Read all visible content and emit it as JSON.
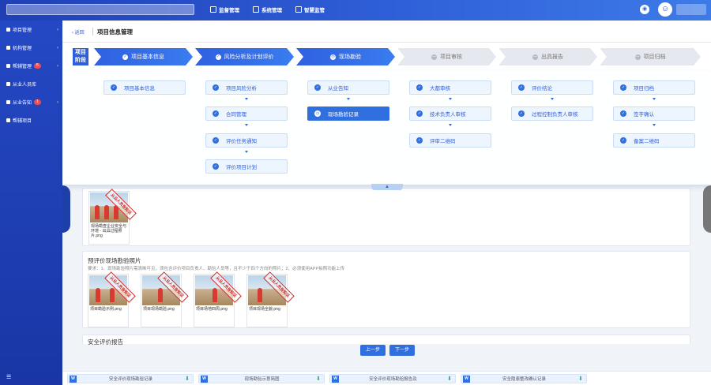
{
  "topbar": {
    "nav": [
      {
        "label": "监督管理",
        "icon": "grid-icon"
      },
      {
        "label": "系统管理",
        "icon": "settings-icon"
      },
      {
        "label": "智慧监管",
        "icon": "chart-icon"
      }
    ],
    "icon1": "◉",
    "icon2": "☺"
  },
  "sidebar": {
    "items": [
      {
        "label": "项目管理",
        "badge": ""
      },
      {
        "label": "机构管理",
        "badge": ""
      },
      {
        "label": "帮辅管理",
        "badge": "5"
      },
      {
        "label": "从业人员库",
        "badge": ""
      },
      {
        "label": "从业告知",
        "badge": "1"
      },
      {
        "label": "帮辅项目",
        "badge": ""
      }
    ],
    "footer": "☰"
  },
  "breadcrumb": {
    "back": "‹ 返回",
    "title": "项目信息管理"
  },
  "steps": {
    "phase_label": "项目阶段",
    "items": [
      {
        "label": "项目基本信息",
        "icon": "✓"
      },
      {
        "label": "风险分析及计划评价",
        "icon": "✓"
      },
      {
        "label": "现场勘验",
        "icon": "◷"
      },
      {
        "label": "项目审核",
        "icon": "—"
      },
      {
        "label": "出具报告",
        "icon": "—"
      },
      {
        "label": "项目归档",
        "icon": "—"
      }
    ]
  },
  "flow": {
    "col1": [
      "项目基本信息"
    ],
    "col2": [
      "项目风险分析",
      "合同管理",
      "评价任务通知",
      "评价项目计划"
    ],
    "col3": [
      "从业告知",
      "现场勘验记录"
    ],
    "col4": [
      "大都审核",
      "技术负责人审核",
      "评审二维码"
    ],
    "col5": [
      "评价结论",
      "过程控制负责人审核"
    ],
    "col6": [
      "项目归档",
      "签字确认",
      "备案二维码"
    ],
    "check": "✓",
    "current_icon": "◷",
    "toggle": "▲"
  },
  "upper_card": {
    "photo": {
      "caption": "现场勘查企业安全与环境 - 出具过程照片.png",
      "stamp": "从业人员告知证"
    }
  },
  "site_photos": {
    "title": "预评价现场勘验照片",
    "note": "要求：1、现场勘验照片需清晰可见，须包含评价项目负责人、勘验人员等，且不少于四个方向的照片；2、必须使用APP拍照功能上传",
    "photos": [
      {
        "caption": "项目勘验示例.png",
        "stamp": "从业人员告知证"
      },
      {
        "caption": "项目现场勘验.png",
        "stamp": "从业人员告知证"
      },
      {
        "caption": "项目场地四周.png",
        "stamp": "从业人员告知证"
      },
      {
        "caption": "项目现场全貌.png",
        "stamp": "从业人员告知证"
      }
    ]
  },
  "next_section_title": "安全评价报告",
  "buttons": {
    "prev": "上一步",
    "next": "下一步"
  },
  "files": [
    {
      "name": "安全评价现场勘验记录",
      "icon": "W"
    },
    {
      "name": "现场勘验示意简图",
      "icon": "W"
    },
    {
      "name": "安全评价现场勘验报告及",
      "icon": "W"
    },
    {
      "name": "安全隐患整改确认记录",
      "icon": "W"
    }
  ],
  "colors": {
    "primary": "#2f6fe0",
    "sidebar": "#2448c4",
    "badge": "#f04a4a",
    "stamp": "#d02a2a"
  }
}
